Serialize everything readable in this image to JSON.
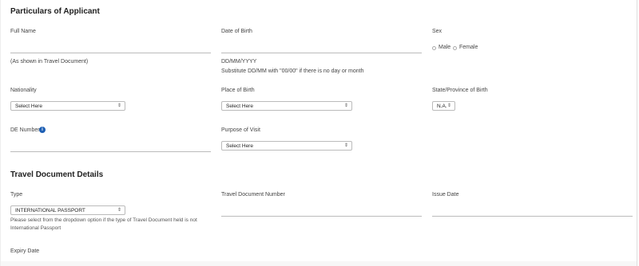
{
  "applicant": {
    "section_title": "Particulars of Applicant",
    "full_name": {
      "label": "Full Name",
      "hint": "(As shown in Travel Document)",
      "value": ""
    },
    "dob": {
      "label": "Date of Birth",
      "format": "DD/MM/YYYY",
      "hint": "Substitute DD/MM with \"00/00\" if there is no day or month",
      "value": ""
    },
    "sex": {
      "label": "Sex",
      "options": [
        "Male",
        "Female"
      ]
    },
    "nationality": {
      "label": "Nationality",
      "value": "Select Here"
    },
    "place_of_birth": {
      "label": "Place of Birth",
      "value": "Select Here"
    },
    "state_of_birth": {
      "label": "State/Province of Birth",
      "value": "N.A."
    },
    "de_number": {
      "label": "DE Number",
      "info_icon": "info-icon",
      "value": ""
    },
    "purpose": {
      "label": "Purpose of Visit",
      "value": "Select Here"
    }
  },
  "travel_doc": {
    "section_title": "Travel Document Details",
    "type": {
      "label": "Type",
      "value": "INTERNATIONAL PASSPORT",
      "hint": "Please select from the dropdown option if the type of Travel Document held is not International Passport"
    },
    "doc_number": {
      "label": "Travel Document Number",
      "value": ""
    },
    "issue_date": {
      "label": "Issue Date",
      "value": ""
    },
    "expiry_date": {
      "label": "Expiry Date"
    }
  }
}
